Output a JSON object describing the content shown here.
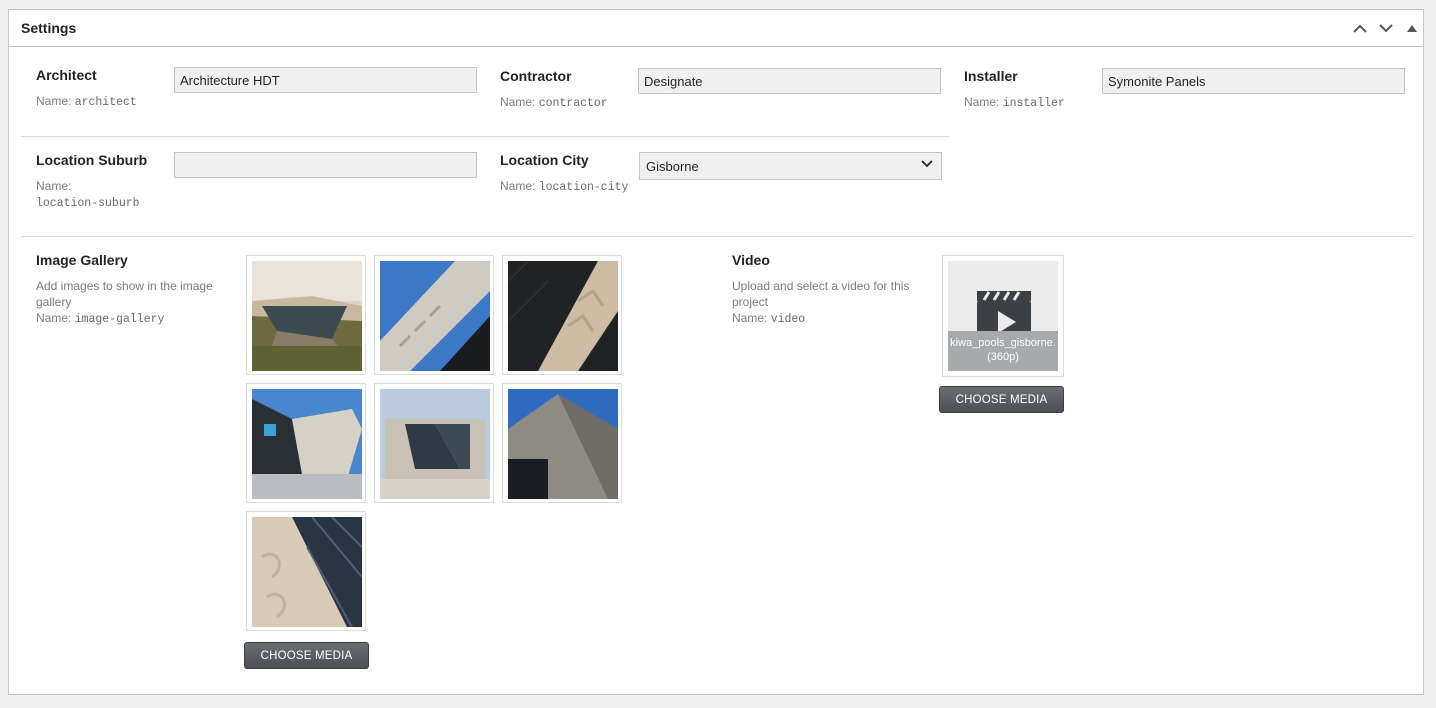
{
  "panel": {
    "title": "Settings"
  },
  "fields": {
    "architect": {
      "label": "Architect",
      "hint_prefix": "Name:",
      "name": "architect",
      "value": "Architecture HDT"
    },
    "contractor": {
      "label": "Contractor",
      "hint_prefix": "Name:",
      "name": "contractor",
      "value": "Designate"
    },
    "installer": {
      "label": "Installer",
      "hint_prefix": "Name:",
      "name": "installer",
      "value": "Symonite Panels"
    },
    "location_suburb": {
      "label": "Location Suburb",
      "hint_prefix": "Name:",
      "name": "location-suburb",
      "value": ""
    },
    "location_city": {
      "label": "Location City",
      "hint_prefix": "Name:",
      "name": "location-city",
      "value": "Gisborne"
    }
  },
  "gallery": {
    "label": "Image Gallery",
    "description": "Add images to show in the image gallery",
    "hint_prefix": "Name:",
    "name": "image-gallery",
    "button": "CHOOSE MEDIA",
    "image_count": 7
  },
  "video": {
    "label": "Video",
    "description": "Upload and select a video for this project",
    "hint_prefix": "Name:",
    "name": "video",
    "file_caption_1": "kiwa_pools_gisborne.",
    "file_caption_2": "(360p)",
    "button": "CHOOSE MEDIA"
  },
  "colors": {
    "accent_button": "#50575e",
    "input_bg": "#f0f0f1",
    "border": "#c3c4c7"
  }
}
